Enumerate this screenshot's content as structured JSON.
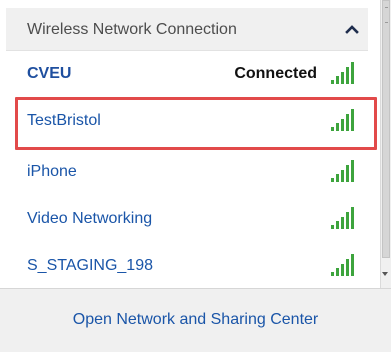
{
  "header": {
    "title": "Wireless Network Connection",
    "collapse_icon": "chevron-up-icon"
  },
  "networks": [
    {
      "name": "CVEU",
      "status": "Connected",
      "signal_bars": 5,
      "bold": true
    },
    {
      "name": "TestBristol",
      "status": "",
      "signal_bars": 5,
      "highlighted": true
    },
    {
      "name": "iPhone",
      "status": "",
      "signal_bars": 5
    },
    {
      "name": "Video Networking",
      "status": "",
      "signal_bars": 5
    },
    {
      "name": "S_STAGING_198",
      "status": "",
      "signal_bars": 5
    }
  ],
  "footer": {
    "link_label": "Open Network and Sharing Center"
  },
  "colors": {
    "link": "#1a55a8",
    "signal": "#3da43d",
    "highlight_border": "#e24a4a",
    "header_bg": "#f0f0f0"
  }
}
